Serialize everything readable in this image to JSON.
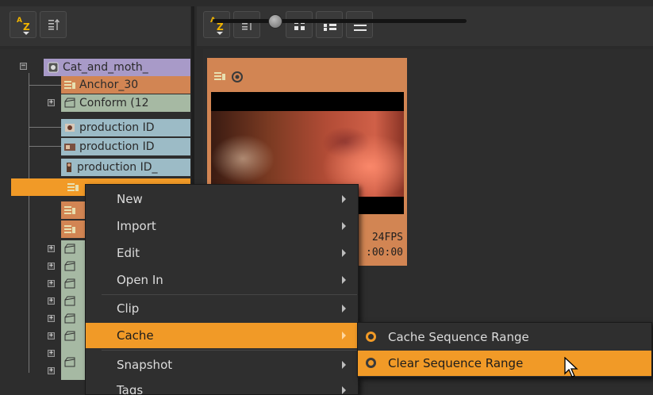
{
  "toolbar_left": {
    "sort_az": {
      "a": "A",
      "z": "Z"
    },
    "icons": [
      "sort-az-icon",
      "sort-order-icon"
    ]
  },
  "toolbar_right": {
    "sort_az": {
      "a": "A",
      "z": "Z"
    },
    "icons": [
      "sort-az-icon",
      "sort-order-icon",
      "thumbnail-view-icon",
      "detail-view-icon",
      "list-view-icon"
    ],
    "zoom_slider_value": 0.27
  },
  "tree": {
    "root": {
      "label": "Cat_and_moth_",
      "color": "#a89ac8"
    },
    "items": [
      {
        "label": "Anchor_30",
        "icon": "sequence-icon",
        "color": "#d28553"
      },
      {
        "label": "Conform (12",
        "icon": "bin-icon",
        "color": "#a6b9a3"
      },
      {
        "label": "production ID",
        "icon": "clip-icon",
        "color": "#9cbbc6"
      },
      {
        "label": "production ID",
        "icon": "clip-icon",
        "color": "#9cbbc6"
      },
      {
        "label": "production ID_",
        "icon": "clip-icon",
        "color": "#9cbbc6"
      },
      {
        "label": "",
        "icon": "sequence-icon",
        "color": "#f19a27"
      },
      {
        "label": "",
        "icon": "sequence-icon",
        "color": "#d28553"
      },
      {
        "label": "",
        "icon": "sequence-icon",
        "color": "#d28553"
      },
      {
        "label": "",
        "icon": "bin-icon",
        "color": "#a6b9a3"
      },
      {
        "label": "",
        "icon": "bin-icon",
        "color": "#a6b9a3"
      },
      {
        "label": "",
        "icon": "bin-icon",
        "color": "#a6b9a3"
      },
      {
        "label": "",
        "icon": "bin-icon",
        "color": "#a6b9a3"
      },
      {
        "label": "",
        "icon": "bin-icon",
        "color": "#a6b9a3"
      },
      {
        "label": "",
        "icon": "bin-icon",
        "color": "#a6b9a3"
      },
      {
        "label": "",
        "icon": "bin-icon",
        "color": "#a6b9a3"
      }
    ]
  },
  "card": {
    "color": "#d28553",
    "fps": "24FPS",
    "timecode": ":00:00"
  },
  "context_menu": {
    "items": [
      {
        "label": "New"
      },
      {
        "label": "Import"
      },
      {
        "label": "Edit"
      },
      {
        "label": "Open In"
      },
      {
        "label": "Clip"
      },
      {
        "label": "Cache"
      },
      {
        "label": "Snapshot"
      },
      {
        "label": "Tags"
      }
    ]
  },
  "cache_submenu": {
    "items": [
      {
        "label": "Cache Sequence Range"
      },
      {
        "label": "Clear Sequence Range"
      }
    ]
  },
  "colors": {
    "accent": "#f19a27",
    "sequence": "#d28553",
    "bin": "#a6b9a3",
    "clip": "#9cbbc6",
    "project": "#a89ac8"
  }
}
